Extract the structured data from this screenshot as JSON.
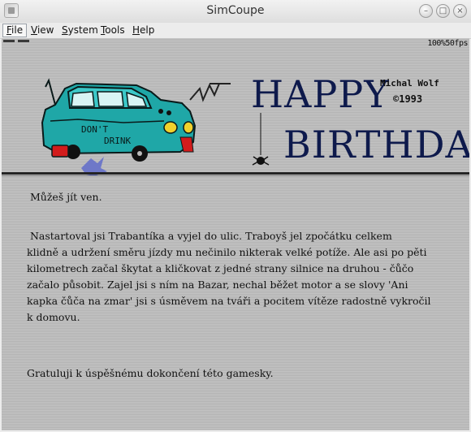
{
  "window": {
    "title": "SimCoupe",
    "buttons": [
      "minimize",
      "maximize",
      "close"
    ]
  },
  "menu": {
    "items": [
      "File",
      "View",
      "System",
      "Tools",
      "Help"
    ],
    "active": "File"
  },
  "screen": {
    "fps": "100%50fps",
    "header": {
      "happy": "HAPPY",
      "birthday": "BIRTHDAY",
      "author": "Michal Wolf",
      "year": "©1993",
      "car_sign_line1": "DON'T",
      "car_sign_line2": "DRINK"
    },
    "lines": [
      " Můžeš jít ven.",
      "",
      " Nastartoval jsi Trabantíka a vyjel do ulic. Traboуš jel zpočátku celkem",
      "klidně a udržení směru jízdy mu nečinilo nikterak velké potíže. Ale asi po pěti",
      "kilometrech začal škytat a kličkovat z jedné strany silnice na druhou - čůčo",
      "začalo působit. Zajel jsi s ním na Bazar, nechal běžet motor a se slovy 'Ani",
      "kapka čůča na zmar' jsi s úsměvem na tváři a pocitem vítěze radostně vykročil",
      "k domovu.",
      "",
      "Gratuluji k úspěšnému dokončení této gamesky."
    ]
  },
  "colors": {
    "screen_bg": "#bdbdbd",
    "heading_blue": "#0e1a4c",
    "car_teal": "#1fa7a7",
    "text": "#111111"
  }
}
